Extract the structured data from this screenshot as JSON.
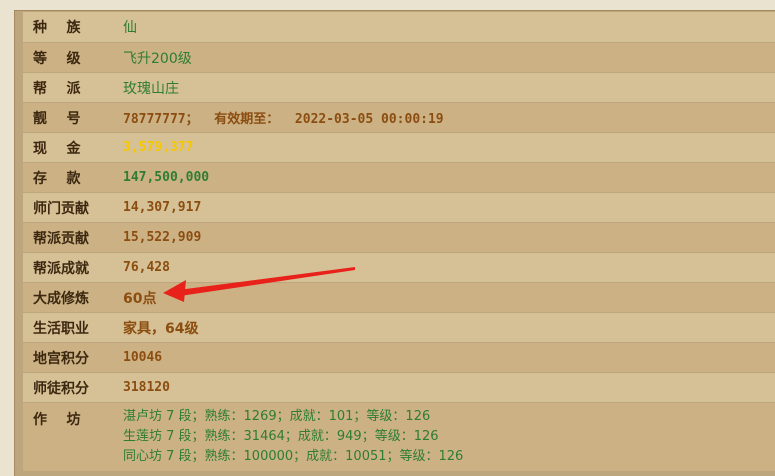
{
  "rows": [
    {
      "label": "种    族",
      "value": "仙",
      "color": "green"
    },
    {
      "label": "等    级",
      "value": "飞升200级",
      "color": "green"
    },
    {
      "label": "帮    派",
      "value": "玫瑰山庄",
      "color": "green"
    },
    {
      "label": "靓    号",
      "value": "78777777；  有效期至：  2022-03-05 00:00:19",
      "color": "brown"
    },
    {
      "label": "现    金",
      "value": "3,579,377",
      "color": "yellow"
    },
    {
      "label": "存    款",
      "value": "147,500,000",
      "color": "green"
    },
    {
      "label": "师门贡献",
      "value": "14,307,917",
      "color": "brown"
    },
    {
      "label": "帮派贡献",
      "value": "15,522,909",
      "color": "brown"
    },
    {
      "label": "帮派成就",
      "value": "76,428",
      "color": "brown"
    },
    {
      "label": "大成修炼",
      "value": "60点",
      "color": "brown"
    },
    {
      "label": "生活职业",
      "value": "家具，64级",
      "color": "brown"
    },
    {
      "label": "地宫积分",
      "value": "10046",
      "color": "brown"
    },
    {
      "label": "师徒积分",
      "value": "318120",
      "color": "brown"
    }
  ],
  "workshop": {
    "label": "作    坊",
    "lines": [
      "湛卢坊 7 段；熟练：1269；成就：101；等级：126",
      "生莲坊 7 段；熟练：31464；成就：949；等级：126",
      "同心坊 7 段；熟练：100000；成就：10051；等级：126"
    ]
  },
  "colors": {
    "row_light": "#d6c095",
    "row_dark": "#ccb184",
    "green": "#2e7d32",
    "brown": "#8b4d10",
    "yellow": "#f5c800",
    "arrow": "#e8221b"
  },
  "annotation": {
    "icon": "red-arrow-icon",
    "points_to": "大成修炼"
  }
}
